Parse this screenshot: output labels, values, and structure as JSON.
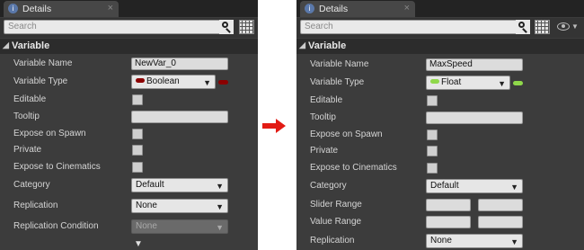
{
  "left": {
    "tab": {
      "title": "Details",
      "close": "×",
      "icon": "details-icon"
    },
    "search": {
      "placeholder": "Search"
    },
    "section": {
      "title": "Variable",
      "arrow": "◢"
    },
    "rows": {
      "variable_name": {
        "label": "Variable Name",
        "value": "NewVar_0"
      },
      "variable_type": {
        "label": "Variable Type",
        "value": "Boolean",
        "pin_color": "#8b0000"
      },
      "editable": {
        "label": "Editable"
      },
      "tooltip": {
        "label": "Tooltip",
        "value": ""
      },
      "expose_on_spawn": {
        "label": "Expose on Spawn"
      },
      "private": {
        "label": "Private"
      },
      "expose_to_cinematics": {
        "label": "Expose to Cinematics"
      },
      "category": {
        "label": "Category",
        "value": "Default"
      },
      "replication": {
        "label": "Replication",
        "value": "None"
      },
      "replication_condition": {
        "label": "Replication Condition",
        "value": "None"
      }
    },
    "more_arrow": "▼"
  },
  "right": {
    "tab": {
      "title": "Details",
      "close": "×",
      "icon": "details-icon"
    },
    "search": {
      "placeholder": "Search"
    },
    "section": {
      "title": "Variable",
      "arrow": "◢"
    },
    "rows": {
      "variable_name": {
        "label": "Variable Name",
        "value": "MaxSpeed"
      },
      "variable_type": {
        "label": "Variable Type",
        "value": "Float",
        "pin_color": "#8fd84a"
      },
      "editable": {
        "label": "Editable"
      },
      "tooltip": {
        "label": "Tooltip",
        "value": ""
      },
      "expose_on_spawn": {
        "label": "Expose on Spawn"
      },
      "private": {
        "label": "Private"
      },
      "expose_to_cinematics": {
        "label": "Expose to Cinematics"
      },
      "category": {
        "label": "Category",
        "value": "Default"
      },
      "slider_range": {
        "label": "Slider Range"
      },
      "value_range": {
        "label": "Value Range"
      },
      "replication": {
        "label": "Replication",
        "value": "None"
      }
    }
  },
  "colors": {
    "arrow": "#e21b14",
    "panel": "#3c3c3c"
  }
}
